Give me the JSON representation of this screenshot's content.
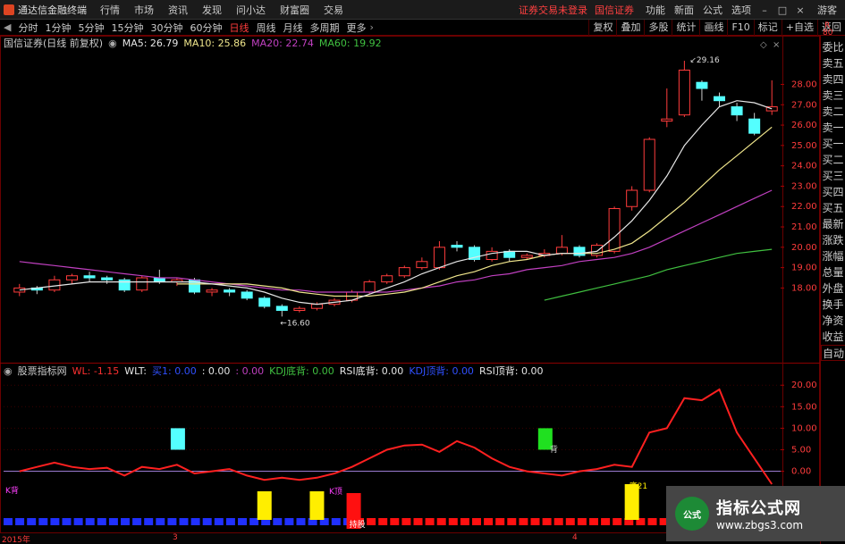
{
  "app": {
    "title": "通达信金融终端",
    "menu": [
      "行情",
      "市场",
      "资讯",
      "发现",
      "问小达",
      "财富圈",
      "交易"
    ],
    "warning": "证券交易未登录",
    "broker": "国信证券",
    "right_menu": [
      "功能",
      "新面",
      "公式",
      "选项"
    ],
    "guest": "游客",
    "win_buttons": {
      "minimize": "–",
      "restore": "□",
      "close": "×"
    }
  },
  "toolbar": {
    "periods": [
      "分时",
      "1分钟",
      "5分钟",
      "15分钟",
      "30分钟",
      "60分钟",
      "日线",
      "周线",
      "月线",
      "多周期",
      "更多"
    ],
    "active_period": "日线",
    "right_buttons": [
      "复权",
      "叠加",
      "多股",
      "统计",
      "画线",
      "F10",
      "标记",
      "+自选",
      "返回"
    ]
  },
  "stock": {
    "name": "国信证券(日线 前复权)",
    "ma": [
      {
        "label": "MA5: 26.79",
        "color": "#e6e6e6"
      },
      {
        "label": "MA10: 25.86",
        "color": "#f0e68c"
      },
      {
        "label": "MA20: 22.74",
        "color": "#c040c0"
      },
      {
        "label": "MA60: 19.92",
        "color": "#40c040"
      }
    ]
  },
  "indicator": {
    "name": "股票指标网",
    "items": [
      {
        "label": "WL: -1.15",
        "color": "#ff3030"
      },
      {
        "label": "WLT:",
        "color": "#e6e6e6"
      },
      {
        "label": "买1: 0.00",
        "color": "#3050ff"
      },
      {
        "label": ": 0.00",
        "color": "#e6e6e6"
      },
      {
        "label": ": 0.00",
        "color": "#c040c0"
      },
      {
        "label": "KDJ底背: 0.00",
        "color": "#40c040"
      },
      {
        "label": "RSI底背: 0.00",
        "color": "#e6e6e6"
      },
      {
        "label": "KDJ顶背: 0.00",
        "color": "#3050ff"
      },
      {
        "label": "RSI顶背: 0.00",
        "color": "#e6e6e6"
      }
    ]
  },
  "price_axis": [
    "28.00",
    "27.00",
    "26.00",
    "25.00",
    "24.00",
    "23.00",
    "22.00",
    "21.00",
    "20.00",
    "19.00",
    "18.00"
  ],
  "ind_axis": [
    "20.00",
    "15.00",
    "10.00",
    "5.00",
    "0.00"
  ],
  "annotations": {
    "high": "29.16",
    "low": "16.60",
    "bottom_label": "底21"
  },
  "signals": {
    "k_back": "K背",
    "k_top": "K顶",
    "hold": "持股",
    "top_back": "背"
  },
  "dates": [
    "2015年",
    "3",
    "4"
  ],
  "right_panel": [
    "委比",
    "卖五",
    "卖四",
    "卖三",
    "卖二",
    "卖一",
    "买一",
    "买二",
    "买三",
    "买四",
    "买五",
    "最新",
    "涨跌",
    "涨幅",
    "总量",
    "外盘",
    "换手",
    "净资",
    "收益"
  ],
  "right_panel_auto": "自动",
  "corner": {
    "r": "R",
    "num": "80"
  },
  "watermark": {
    "title": "指标公式网",
    "url": "www.zbgs3.com",
    "icon": "公式"
  },
  "candles": [
    {
      "o": 17.8,
      "c": 18.0,
      "h": 18.2,
      "l": 17.6
    },
    {
      "o": 18.0,
      "c": 17.9,
      "h": 18.1,
      "l": 17.7
    },
    {
      "o": 17.9,
      "c": 18.4,
      "h": 18.6,
      "l": 17.8
    },
    {
      "o": 18.4,
      "c": 18.6,
      "h": 18.7,
      "l": 18.2
    },
    {
      "o": 18.6,
      "c": 18.5,
      "h": 18.8,
      "l": 18.3
    },
    {
      "o": 18.5,
      "c": 18.4,
      "h": 18.6,
      "l": 18.2
    },
    {
      "o": 18.4,
      "c": 17.9,
      "h": 18.5,
      "l": 17.8
    },
    {
      "o": 17.9,
      "c": 18.5,
      "h": 18.6,
      "l": 17.8
    },
    {
      "o": 18.5,
      "c": 18.3,
      "h": 18.9,
      "l": 18.2
    },
    {
      "o": 18.3,
      "c": 18.4,
      "h": 18.5,
      "l": 18.1
    },
    {
      "o": 18.4,
      "c": 17.8,
      "h": 18.5,
      "l": 17.7
    },
    {
      "o": 17.8,
      "c": 17.9,
      "h": 18.0,
      "l": 17.6
    },
    {
      "o": 17.9,
      "c": 17.8,
      "h": 18.0,
      "l": 17.6
    },
    {
      "o": 17.8,
      "c": 17.5,
      "h": 17.9,
      "l": 17.4
    },
    {
      "o": 17.5,
      "c": 17.1,
      "h": 17.6,
      "l": 17.0
    },
    {
      "o": 17.1,
      "c": 16.9,
      "h": 17.2,
      "l": 16.6
    },
    {
      "o": 16.9,
      "c": 17.0,
      "h": 17.1,
      "l": 16.8
    },
    {
      "o": 17.0,
      "c": 17.2,
      "h": 17.3,
      "l": 16.9
    },
    {
      "o": 17.2,
      "c": 17.4,
      "h": 17.5,
      "l": 17.1
    },
    {
      "o": 17.4,
      "c": 17.8,
      "h": 17.9,
      "l": 17.3
    },
    {
      "o": 17.8,
      "c": 18.3,
      "h": 18.4,
      "l": 17.7
    },
    {
      "o": 18.3,
      "c": 18.6,
      "h": 18.7,
      "l": 18.2
    },
    {
      "o": 18.6,
      "c": 19.0,
      "h": 19.1,
      "l": 18.5
    },
    {
      "o": 19.0,
      "c": 19.3,
      "h": 19.5,
      "l": 18.9
    },
    {
      "o": 19.0,
      "c": 20.0,
      "h": 20.3,
      "l": 18.9
    },
    {
      "o": 20.1,
      "c": 20.0,
      "h": 20.3,
      "l": 19.8
    },
    {
      "o": 20.0,
      "c": 19.4,
      "h": 20.1,
      "l": 19.3
    },
    {
      "o": 19.4,
      "c": 19.8,
      "h": 20.0,
      "l": 19.3
    },
    {
      "o": 19.8,
      "c": 19.5,
      "h": 19.9,
      "l": 19.3
    },
    {
      "o": 19.5,
      "c": 19.6,
      "h": 19.7,
      "l": 19.4
    },
    {
      "o": 19.6,
      "c": 19.7,
      "h": 19.9,
      "l": 19.5
    },
    {
      "o": 19.7,
      "c": 20.0,
      "h": 20.6,
      "l": 19.6
    },
    {
      "o": 20.0,
      "c": 19.6,
      "h": 20.1,
      "l": 19.5
    },
    {
      "o": 19.6,
      "c": 20.1,
      "h": 20.2,
      "l": 19.5
    },
    {
      "o": 19.8,
      "c": 21.9,
      "h": 22.0,
      "l": 19.7
    },
    {
      "o": 22.0,
      "c": 22.8,
      "h": 23.0,
      "l": 21.8
    },
    {
      "o": 22.8,
      "c": 25.3,
      "h": 25.4,
      "l": 22.7
    },
    {
      "o": 26.2,
      "c": 26.3,
      "h": 27.8,
      "l": 25.9
    },
    {
      "o": 26.5,
      "c": 28.7,
      "h": 29.16,
      "l": 26.4
    },
    {
      "o": 28.1,
      "c": 27.8,
      "h": 28.2,
      "l": 27.2
    },
    {
      "o": 27.4,
      "c": 27.2,
      "h": 27.6,
      "l": 26.9
    },
    {
      "o": 26.9,
      "c": 26.5,
      "h": 27.1,
      "l": 26.2
    },
    {
      "o": 26.3,
      "c": 25.6,
      "h": 26.6,
      "l": 25.5
    },
    {
      "o": 26.7,
      "c": 26.9,
      "h": 28.2,
      "l": 26.5
    }
  ],
  "chart_data": {
    "type": "line",
    "price_range": [
      16.0,
      29.6
    ],
    "ind_range": [
      -3.0,
      21.5
    ],
    "ma5": [
      17.9,
      18.0,
      18.1,
      18.2,
      18.3,
      18.3,
      18.3,
      18.3,
      18.3,
      18.3,
      18.3,
      18.2,
      18.1,
      18.0,
      17.8,
      17.5,
      17.3,
      17.2,
      17.3,
      17.4,
      17.7,
      18.0,
      18.3,
      18.7,
      19.0,
      19.3,
      19.5,
      19.7,
      19.8,
      19.8,
      19.6,
      19.7,
      19.7,
      19.8,
      20.5,
      21.3,
      22.3,
      23.5,
      25.0,
      26.0,
      26.9,
      27.2,
      27.1,
      26.8
    ],
    "ma10": [
      null,
      null,
      null,
      null,
      null,
      null,
      null,
      null,
      null,
      18.2,
      18.2,
      18.2,
      18.2,
      18.2,
      18.1,
      18.0,
      17.8,
      17.7,
      17.6,
      17.6,
      17.6,
      17.7,
      17.8,
      18.0,
      18.3,
      18.6,
      18.8,
      19.1,
      19.3,
      19.4,
      19.6,
      19.7,
      19.7,
      19.7,
      19.9,
      20.2,
      20.8,
      21.5,
      22.2,
      23.0,
      23.8,
      24.5,
      25.2,
      25.9
    ],
    "ma20": [
      19.3,
      19.2,
      19.1,
      19.0,
      18.9,
      18.8,
      18.7,
      18.6,
      18.5,
      18.5,
      18.4,
      18.3,
      18.2,
      18.1,
      18.0,
      17.9,
      17.9,
      17.8,
      17.8,
      17.8,
      17.8,
      17.8,
      17.9,
      18.0,
      18.1,
      18.3,
      18.4,
      18.6,
      18.7,
      18.9,
      19.0,
      19.1,
      19.3,
      19.4,
      19.5,
      19.7,
      20.0,
      20.4,
      20.8,
      21.2,
      21.6,
      22.0,
      22.4,
      22.8
    ],
    "ma60": [
      null,
      null,
      null,
      null,
      null,
      null,
      null,
      null,
      null,
      null,
      null,
      null,
      null,
      null,
      null,
      null,
      null,
      null,
      null,
      null,
      null,
      null,
      null,
      null,
      null,
      null,
      null,
      null,
      null,
      null,
      17.4,
      17.6,
      17.8,
      18.0,
      18.2,
      18.4,
      18.6,
      18.9,
      19.1,
      19.3,
      19.5,
      19.7,
      19.8,
      19.9
    ],
    "wl": [
      0,
      1,
      2,
      1,
      0.5,
      0.8,
      -1,
      1,
      0.5,
      1.5,
      -0.5,
      0,
      0.5,
      -1,
      -2,
      -1.5,
      -2,
      -1.5,
      -0.5,
      1,
      3,
      5,
      6,
      6.2,
      4.5,
      7,
      5.5,
      3,
      1,
      0,
      -0.5,
      -1,
      0,
      0.5,
      1.5,
      1,
      9,
      10,
      17,
      16.5,
      19,
      9,
      3,
      -3
    ]
  }
}
